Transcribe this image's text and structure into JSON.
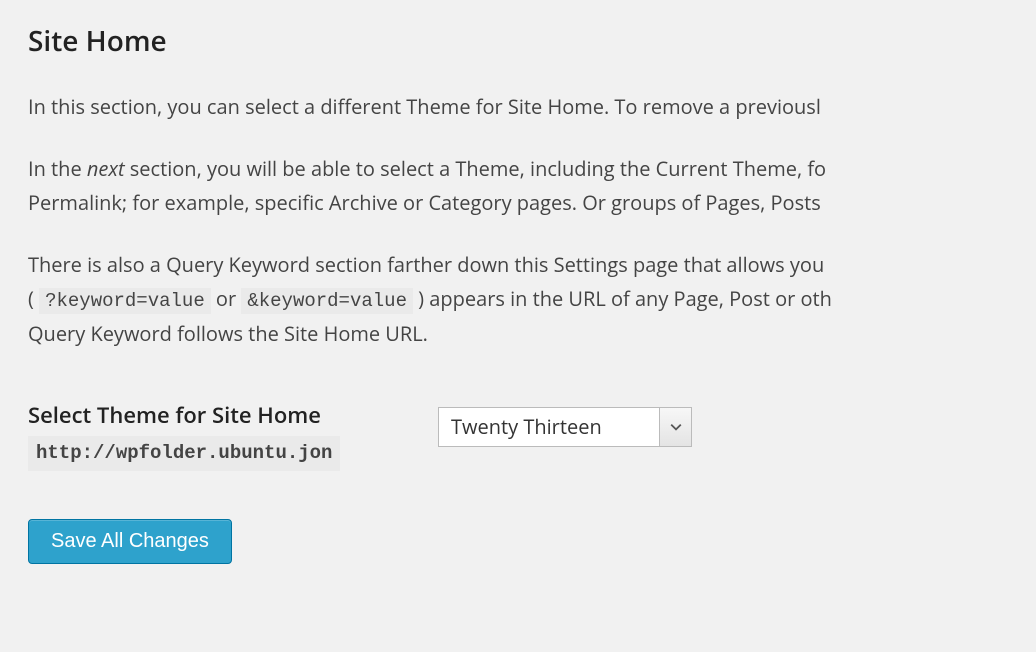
{
  "heading": "Site Home",
  "intro_p1": "In this section, you can select a different Theme for Site Home. To remove a previousl",
  "intro_p2_a": "In the ",
  "intro_p2_next": "next",
  "intro_p2_b": " section, you will be able to select a Theme, including the Current Theme, fo",
  "intro_p2_c": "Permalink; for example, specific Archive or Category pages. Or groups of Pages, Posts ",
  "intro_p3_a": "There is also a Query Keyword section farther down this Settings page that allows you",
  "intro_p3_open": "( ",
  "intro_p3_code1": "?keyword=value",
  "intro_p3_or": "  or  ",
  "intro_p3_code2": "&keyword=value",
  "intro_p3_close": " ) appears in the URL of any Page, Post or oth",
  "intro_p3_d": "Query Keyword follows the Site Home URL.",
  "form": {
    "label_title": "Select Theme for Site Home",
    "label_url": "http://wpfolder.ubuntu.jon",
    "theme_selected": "Twenty Thirteen"
  },
  "save_button": "Save All Changes"
}
